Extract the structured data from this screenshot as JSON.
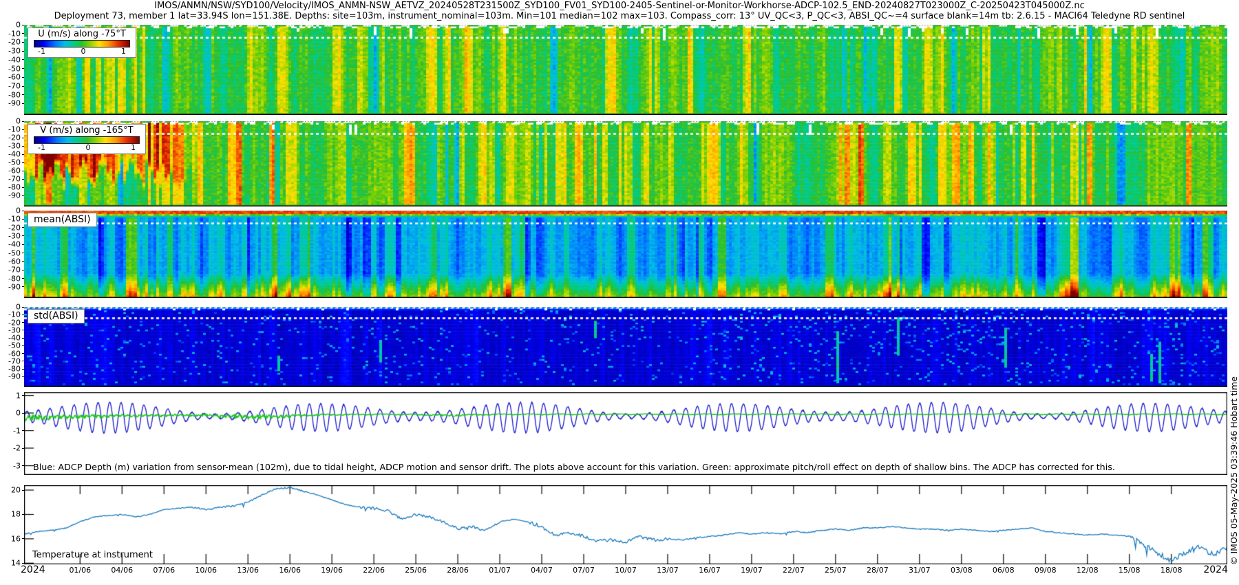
{
  "header": {
    "title_line1": "IMOS/ANMN/NSW/SYD100/Velocity/IMOS_ANMN-NSW_AETVZ_20240528T231500Z_SYD100_FV01_SYD100-2405-Sentinel-or-Monitor-Workhorse-ADCP-102.5_END-20240827T023000Z_C-20250423T045000Z.nc",
    "title_line2": "Deployment 73, member 1 lat=33.94S lon=151.38E. Depths: site=103m, instrument_nominal=103m. Min=101 median=102 max=103. Compass_corr: 13° UV_QC<3, P_QC<3, ABSI_QC~=4 surface blank=14m tb: 2.6.15 - MACI64 Teledyne RD sentinel"
  },
  "watermark": "© IMOS 05-May-2025 03:39:46 Hobart time",
  "legends": {
    "u": {
      "label": "U (m/s) along -75°T",
      "ticks": [
        "-1",
        "0",
        "1"
      ]
    },
    "v": {
      "label": "V (m/s) along -165°T",
      "ticks": [
        "-1",
        "0",
        "1"
      ]
    },
    "absi_mean_label": "mean(ABSI)",
    "absi_std_label": "std(ABSI)"
  },
  "annotations": {
    "depth_note": "Blue: ADCP Depth (m) variation from sensor-mean (102m), due to tidal height, ADCP motion and sensor drift. The plots above account for this variation. Green: approximate pitch/roll effect on depth of shallow bins. The ADCP has corrected for this.",
    "temp_label": "Temperature at instrument"
  },
  "y_axis": {
    "depth_ticks": [
      "0",
      "-10",
      "-20",
      "-30",
      "-40",
      "-50",
      "-60",
      "-70",
      "-80",
      "-90"
    ],
    "depth_var_ticks": [
      "1",
      "0",
      "-1",
      "-2",
      "-3"
    ],
    "temp_ticks": [
      "20",
      "18",
      "16",
      "14"
    ]
  },
  "x_axis": {
    "year_left": "2024",
    "year_right": "2024",
    "date_ticks": [
      "01/06",
      "04/06",
      "07/06",
      "10/06",
      "13/06",
      "16/06",
      "19/06",
      "22/06",
      "25/06",
      "28/06",
      "01/07",
      "04/07",
      "07/07",
      "10/07",
      "13/07",
      "16/07",
      "19/07",
      "22/07",
      "25/07",
      "28/07",
      "31/07",
      "03/08",
      "06/08",
      "09/08",
      "12/08",
      "15/08",
      "18/08"
    ]
  },
  "colors": {
    "jet_colorbar": [
      "#000082",
      "#0000ff",
      "#0078ff",
      "#00beе6",
      "#00cd82",
      "#2dbe2d",
      "#82d200",
      "#ffe100",
      "#ff9600",
      "#eb2d00",
      "#820000"
    ],
    "blue_line": "#1a1acc",
    "green_line": "#16c816",
    "temp_line": "#1878be"
  },
  "chart_data": [
    {
      "id": "u_velocity",
      "type": "heatmap",
      "title": "U (m/s) along -75°T",
      "colormap": "jet",
      "vmin": -1,
      "vmax": 1,
      "colorbar_ticks": [
        -1,
        0,
        1
      ],
      "x_span": "28/05/2024 to ~22/08/2024",
      "y_depth_m": [
        0,
        -103
      ],
      "y_ticks": [
        0,
        -10,
        -20,
        -30,
        -40,
        -50,
        -60,
        -70,
        -80,
        -90
      ],
      "summary": "Cross-shore velocity mostly 0 to +0.3 m/s (green to yellow-green) for the whole record, organised in narrow vertical streaks of about +/-0.2 m/s; occasional brighter yellow columns; a few white flagged bins in the top ~15 m; dashed green shallowest-bin row at 0 m and dotted white surface-blank line at ~14 m."
    },
    {
      "id": "v_velocity",
      "type": "heatmap",
      "title": "V (m/s) along -165°T",
      "colormap": "jet",
      "vmin": -1,
      "vmax": 1,
      "colorbar_ticks": [
        -1,
        0,
        1
      ],
      "x_span": "28/05/2024 to ~22/08/2024",
      "y_depth_m": [
        0,
        -103
      ],
      "y_ticks": [
        0,
        -10,
        -20,
        -30,
        -40,
        -50,
        -60,
        -70,
        -80,
        -90
      ],
      "summary": "Alongshore velocity: strong event from deployment start until ~09/06 with V about +0.5 to +1.0 m/s (orange to dark red) over the upper 60-85 m; rest of record mostly -0.1 to +0.3 m/s (green) with scattered yellow/orange streak columns and occasional cyan (negative) streaks."
    },
    {
      "id": "absi_mean",
      "type": "heatmap",
      "title": "mean(ABSI)",
      "colormap": "jet",
      "x_span": "28/05/2024 to ~22/08/2024",
      "y_depth_m": [
        0,
        -103
      ],
      "y_ticks": [
        0,
        -10,
        -20,
        -30,
        -40,
        -50,
        -60,
        -70,
        -80,
        -90
      ],
      "summary": "Mean acoustic backscatter: very high (orange/red) in the top ~6 m, a green band near ~8 m, low mid-water values (blue/cyan vertical streaks), and enhanced yellow/green backscatter below ~75 m to the bottom of the profile; dotted white surface-blank line at ~14 m."
    },
    {
      "id": "absi_std",
      "type": "heatmap",
      "title": "std(ABSI)",
      "colormap": "jet",
      "x_span": "28/05/2024 to ~22/08/2024",
      "y_depth_m": [
        0,
        -103
      ],
      "y_ticks": [
        0,
        -10,
        -20,
        -30,
        -40,
        -50,
        -60,
        -70,
        -80,
        -90
      ],
      "summary": "Std of backscatter: uniformly low (dark navy) through the water column with sparse lighter-blue speckle and occasional cyan vertical streaks (more frequent in the second half); banded light-blue/white rows in the top ~6 m; dotted white surface-blank line at ~14 m."
    },
    {
      "id": "depth_variation",
      "type": "line",
      "ylim": [
        -3.5,
        1.2
      ],
      "y_ticks": [
        1,
        0,
        -1,
        -2,
        -3
      ],
      "series": [
        {
          "name": "ADCP depth variation (m)",
          "color": "blue",
          "description": "Tidal oscillation, apparent period ~0.85 day, amplitude modulated on a ~14.8-day spring-neap cycle; peaks ~ +0.6 m and troughs ~ -1.1 m about the sensor-mean depth of 102 m."
        },
        {
          "name": "pitch/roll effect on shallow-bin depth (m)",
          "color": "green",
          "description": "Near 0 m, with downward excursions to ~ -0.5 m during the first ~10 days and again around mid-June."
        }
      ],
      "annotation": "Blue: ADCP Depth (m) variation from sensor-mean (102m), due to tidal height, ADCP motion and sensor drift. The plots above account for this variation. Green: approximate pitch/roll effect on depth of shallow bins. The ADCP has corrected for this."
    },
    {
      "id": "temperature",
      "type": "line",
      "title": "Temperature at instrument",
      "ylim": [
        13.8,
        20.4
      ],
      "y_ticks": [
        20,
        18,
        16,
        14
      ],
      "x_start": "28/05/2024",
      "x_step_days": 1,
      "values_daily": [
        16.4,
        16.6,
        16.7,
        16.9,
        17.4,
        17.8,
        17.9,
        18.0,
        17.8,
        18.0,
        18.4,
        18.5,
        18.6,
        18.4,
        18.6,
        18.7,
        19.0,
        19.6,
        20.1,
        20.2,
        19.9,
        19.6,
        19.2,
        18.8,
        18.6,
        18.5,
        18.3,
        17.6,
        18.0,
        17.8,
        17.4,
        16.8,
        17.0,
        16.7,
        17.4,
        17.6,
        17.4,
        17.0,
        16.3,
        16.5,
        16.2,
        15.8,
        15.9,
        15.7,
        16.2,
        15.9,
        16.0,
        15.9,
        16.1,
        16.2,
        16.3,
        16.5,
        16.4,
        16.5,
        16.4,
        16.6,
        16.5,
        16.7,
        16.8,
        16.7,
        16.9,
        16.9,
        17.0,
        16.9,
        16.8,
        16.8,
        16.7,
        16.8,
        16.7,
        16.6,
        16.7,
        16.8,
        16.9,
        16.6,
        16.5,
        16.4,
        16.3,
        16.4,
        16.3,
        16.2,
        15.6,
        14.8,
        14.2,
        14.9,
        15.3,
        14.7,
        15.3
      ]
    }
  ]
}
